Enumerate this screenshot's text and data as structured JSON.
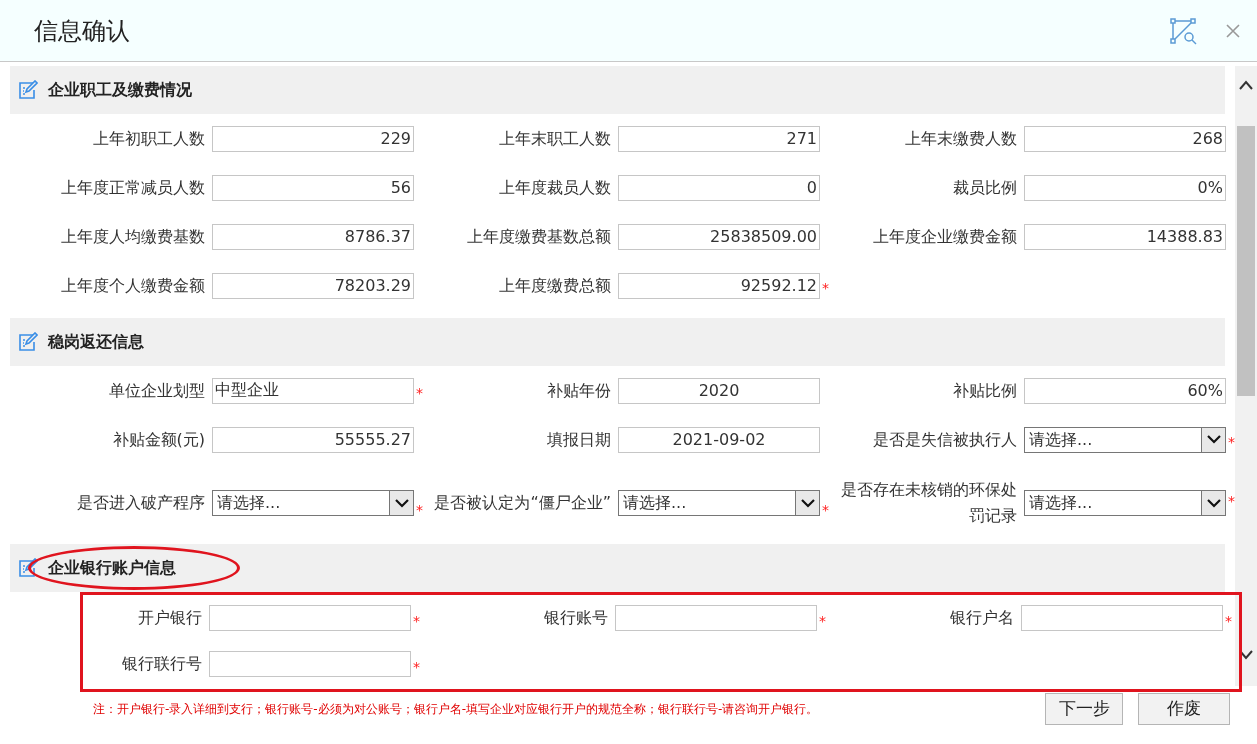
{
  "window": {
    "title": "信息确认"
  },
  "sections": [
    {
      "title": "企业职工及缴费情况",
      "highlighted": false,
      "boxed": false,
      "rows": [
        [
          {
            "label": "上年初职工人数",
            "kind": "number",
            "value": "229"
          },
          {
            "label": "上年末职工人数",
            "kind": "number",
            "value": "271"
          },
          {
            "label": "上年末缴费人数",
            "kind": "number",
            "value": "268"
          }
        ],
        [
          {
            "label": "上年度正常减员人数",
            "kind": "number",
            "value": "56"
          },
          {
            "label": "上年度裁员人数",
            "kind": "number",
            "value": "0"
          },
          {
            "label": "裁员比例",
            "kind": "number",
            "value": "0%"
          }
        ],
        [
          {
            "label": "上年度人均缴费基数",
            "kind": "number",
            "value": "8786.37"
          },
          {
            "label": "上年度缴费基数总额",
            "kind": "number",
            "value": "25838509.00"
          },
          {
            "label": "上年度企业缴费金额",
            "kind": "number",
            "value": "14388.83"
          }
        ],
        [
          {
            "label": "上年度个人缴费金额",
            "kind": "number",
            "value": "78203.29"
          },
          {
            "label": "上年度缴费总额",
            "kind": "number",
            "value": "92592.12",
            "asterisk": "*"
          }
        ]
      ]
    },
    {
      "title": "稳岗返还信息",
      "highlighted": false,
      "boxed": false,
      "rows": [
        [
          {
            "label": "单位企业划型",
            "kind": "text",
            "value": "中型企业",
            "asterisk": "*"
          },
          {
            "label": "补贴年份",
            "kind": "centered",
            "value": "2020"
          },
          {
            "label": "补贴比例",
            "kind": "number",
            "value": "60%"
          }
        ],
        [
          {
            "label": "补贴金额(元)",
            "kind": "number",
            "value": "55555.27"
          },
          {
            "label": "填报日期",
            "kind": "centered",
            "value": "2021-09-02"
          },
          {
            "label": "是否是失信被执行人",
            "kind": "select",
            "value": "请选择...",
            "asterisk": "*"
          }
        ],
        [
          {
            "label": "是否进入破产程序",
            "kind": "select",
            "value": "请选择...",
            "asterisk": "*"
          },
          {
            "label": "是否被认定为“僵尸企业”",
            "kind": "select",
            "value": "请选择...",
            "asterisk": "*"
          },
          {
            "label": "是否存在未核销的环保处罚记录",
            "kind": "select",
            "value": "请选择...",
            "asterisk": "*"
          }
        ]
      ]
    },
    {
      "title": "企业银行账户信息",
      "highlighted": true,
      "boxed": true,
      "rows": [
        [
          {
            "label": "开户银行",
            "kind": "text",
            "asterisk": "*"
          },
          {
            "label": "银行账号",
            "kind": "text",
            "asterisk": "*"
          },
          {
            "label": "银行户名",
            "kind": "text",
            "asterisk": "*"
          }
        ],
        [
          {
            "label": "银行联行号",
            "kind": "text",
            "asterisk": "*"
          }
        ]
      ]
    }
  ],
  "note": "注：开户银行-录入详细到支行；银行账号-必须为对公账号；银行户名-填写企业对应银行开户的规范全称；银行联行号-请咨询开户银行。",
  "buttons": [
    "下一步",
    "作废"
  ]
}
